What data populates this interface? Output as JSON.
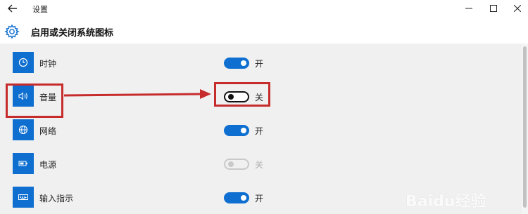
{
  "window": {
    "title": "设置",
    "controls": [
      "minimize",
      "maximize",
      "close"
    ]
  },
  "page": {
    "title": "启用或关闭系统图标"
  },
  "items": [
    {
      "label": "时钟",
      "icon": "clock-icon",
      "state": "on",
      "state_label": "开"
    },
    {
      "label": "音量",
      "icon": "volume-icon",
      "state": "off",
      "state_label": "关"
    },
    {
      "label": "网络",
      "icon": "network-icon",
      "state": "on",
      "state_label": "开"
    },
    {
      "label": "电源",
      "icon": "battery-icon",
      "state": "disabled",
      "state_label": "关"
    },
    {
      "label": "输入指示",
      "icon": "keyboard-icon",
      "state": "on",
      "state_label": "开"
    }
  ],
  "colors": {
    "accent": "#0e6fd1",
    "annotation": "#c72c2c",
    "content_bg": "#f0f0f0"
  },
  "watermark": {
    "text": "Baidu经验"
  }
}
